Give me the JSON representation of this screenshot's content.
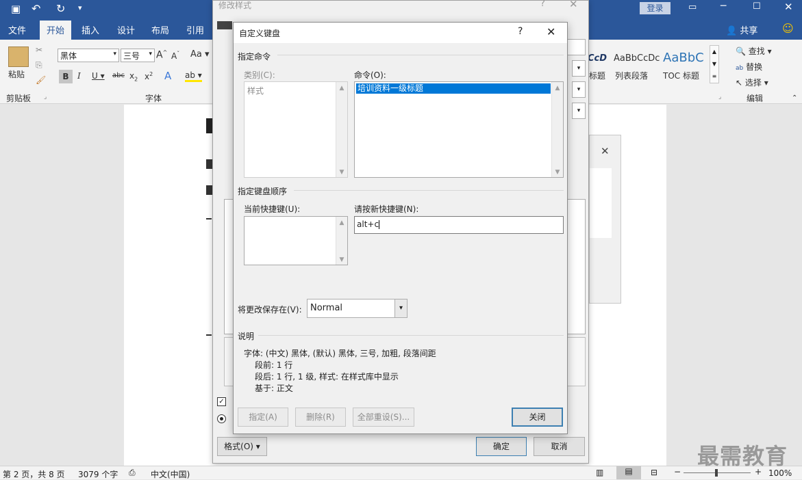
{
  "window": {
    "login_label": "登录",
    "share_label": "共享"
  },
  "tabs": [
    "文件",
    "开始",
    "插入",
    "设计",
    "布局",
    "引用"
  ],
  "ribbon": {
    "clipboard_label": "剪贴板",
    "paste_label": "粘贴",
    "font_group_label": "字体",
    "font_name": "黑体",
    "font_size": "三号",
    "edit_group_label": "编辑",
    "find_label": "查找",
    "replace_label": "替换",
    "select_label": "选择",
    "styles": [
      "CcD",
      "AaBbCcDc",
      "AaBbC"
    ],
    "style_names": [
      "标题",
      "列表段落",
      "TOC 标题"
    ]
  },
  "back_dialog": {
    "title": "修改样式",
    "format_button": "格式(O)",
    "ok_button": "确定",
    "cancel_button": "取消"
  },
  "dialog": {
    "title": "自定义键盘",
    "help": "?",
    "specify_command": "指定命令",
    "category_label": "类别(C):",
    "category_items": [
      "样式"
    ],
    "command_label": "命令(O):",
    "command_items": [
      "培训资料一级标题"
    ],
    "key_sequence": "指定键盘顺序",
    "current_keys_label": "当前快捷键(U):",
    "new_key_label": "请按新快捷键(N):",
    "new_key_value": "alt+c",
    "save_in_label": "将更改保存在(V):",
    "save_in_value": "Normal",
    "description_header": "说明",
    "description_lines": [
      "字体: (中文) 黑体, (默认) 黑体, 三号, 加粗, 段落间距",
      "段前: 1 行",
      "段后: 1 行, 1 级, 样式: 在样式库中显示",
      "基于: 正文"
    ],
    "buttons": {
      "assign": "指定(A)",
      "remove": "删除(R)",
      "reset_all": "全部重设(S)...",
      "close": "关闭"
    }
  },
  "status": {
    "page": "第 2 页，共 8 页",
    "words": "3079 个字",
    "lang": "中文(中国)",
    "zoom": "100%"
  },
  "watermark": "最需教育"
}
